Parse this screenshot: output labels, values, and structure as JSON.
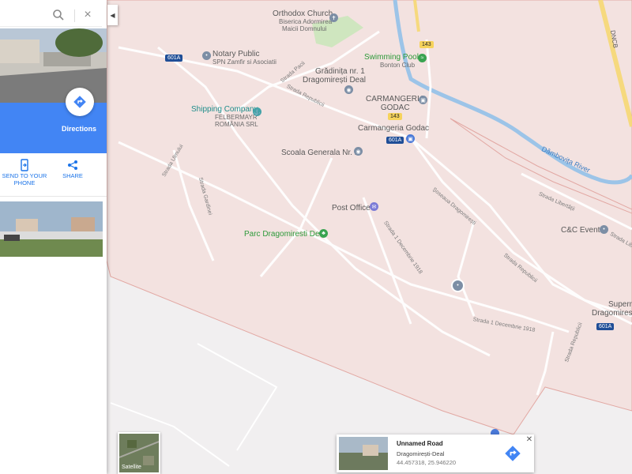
{
  "search": {
    "placeholder": "",
    "value": ""
  },
  "panel": {
    "directions_label": "Directions",
    "actions": [
      {
        "label_line1": "SEND TO YOUR",
        "label_line2": "PHONE",
        "icon": "phone-icon"
      },
      {
        "label_line1": "SHARE",
        "label_line2": "",
        "icon": "share-icon"
      }
    ],
    "accent_color": "#4285f4"
  },
  "map": {
    "pois": [
      {
        "title": "Orthodox Church",
        "sub1": "Biserica Adormirea",
        "sub2": "Maicii Domnului",
        "icon": "church-icon"
      },
      {
        "title": "Notary Public",
        "sub1": "SPN Zamfir si Asociatii",
        "sub2": "",
        "icon": "pin-icon"
      },
      {
        "title": "Swimming Pool",
        "sub1": "Bonton Club",
        "sub2": "",
        "icon": "pool-icon"
      },
      {
        "title": "Grădinița nr. 1",
        "sub1": "Dragomirești Deal",
        "sub2": "",
        "icon": "school-icon"
      },
      {
        "title": "Shipping Company",
        "sub1": "FELBERMAYR",
        "sub2": "ROMÂNIA SRL",
        "icon": "shipping-icon"
      },
      {
        "title": "CARMANGERIA",
        "sub1": "GODAC",
        "sub2": "",
        "icon": "shop-icon"
      },
      {
        "title": "Carmangeria Godac",
        "sub1": "",
        "sub2": "",
        "icon": "shop-icon"
      },
      {
        "title": "Scoala Generala Nr. 2",
        "sub1": "",
        "sub2": "",
        "icon": "school-icon"
      },
      {
        "title": "Post Office",
        "sub1": "",
        "sub2": "",
        "icon": "post-icon"
      },
      {
        "title": "Parc Dragomiresti Deal",
        "sub1": "",
        "sub2": "",
        "icon": "park-icon"
      },
      {
        "title": "C&C Events",
        "sub1": "",
        "sub2": "",
        "icon": "pin-icon"
      },
      {
        "title": "Superm",
        "sub1": "Dragomiresti-D",
        "sub2": "",
        "icon": "shop-icon"
      }
    ],
    "streets": [
      "Strada Republicii",
      "Strada Pacii",
      "Strada Ulmului",
      "Strada Gardinei",
      "Strada 1 Decembrie 1918",
      "Șoseaua Dragomirești",
      "Strada Republicii",
      "Strada Libertății",
      "Strada Liber",
      "Strada Republicii",
      "Strada 1 Decembrie 1918"
    ],
    "water": "Dâmbovița River",
    "road_badges": [
      "601A",
      "143",
      "143",
      "601A",
      "601A",
      "DNCB"
    ]
  },
  "satellite": {
    "label": "Satellite"
  },
  "card": {
    "title": "Unnamed Road",
    "subtitle": "Dragomirești-Deal",
    "coords": "44.457318, 25.946220"
  }
}
